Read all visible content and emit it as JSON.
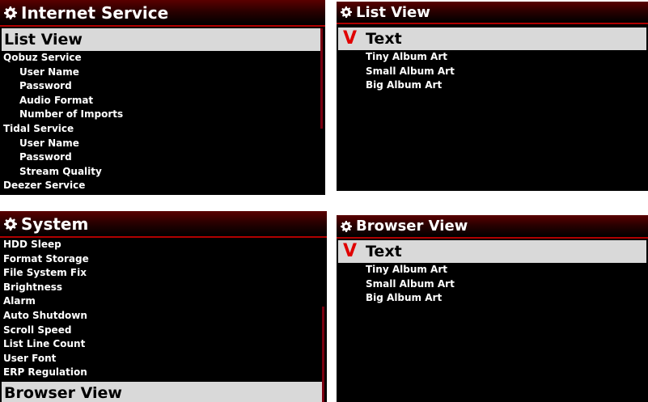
{
  "panels": {
    "internet_service": {
      "title": "Internet Service",
      "selected": "List View",
      "items": [
        {
          "label": "Qobuz Service"
        },
        {
          "label": "User Name"
        },
        {
          "label": "Password"
        },
        {
          "label": "Audio Format"
        },
        {
          "label": "Number of Imports"
        },
        {
          "label": "Tidal Service"
        },
        {
          "label": "User Name"
        },
        {
          "label": "Password"
        },
        {
          "label": "Stream Quality"
        },
        {
          "label": "Deezer Service"
        }
      ]
    },
    "list_view": {
      "title": "List View",
      "check_mark": "V",
      "selected": "Text",
      "options": [
        {
          "label": "Tiny Album Art"
        },
        {
          "label": "Small Album Art"
        },
        {
          "label": "Big Album Art"
        }
      ]
    },
    "system": {
      "title": "System",
      "items": [
        {
          "label": "HDD Sleep"
        },
        {
          "label": "Format Storage"
        },
        {
          "label": "File System Fix"
        },
        {
          "label": "Brightness"
        },
        {
          "label": "Alarm"
        },
        {
          "label": "Auto Shutdown"
        },
        {
          "label": "Scroll Speed"
        },
        {
          "label": "List Line Count"
        },
        {
          "label": "User Font"
        },
        {
          "label": "ERP Regulation"
        }
      ],
      "selected": "Browser View"
    },
    "browser_view": {
      "title": "Browser View",
      "check_mark": "V",
      "selected": "Text",
      "options": [
        {
          "label": "Tiny Album Art"
        },
        {
          "label": "Small Album Art"
        },
        {
          "label": "Big Album Art"
        }
      ]
    }
  },
  "colors": {
    "panel_bg": "#000000",
    "title_gradient_top": "#5a0000",
    "selection_bg": "#d9d9d9",
    "check_mark": "#e00000",
    "scrollbar": "#7a0010"
  },
  "icons": {
    "title_icon": "gear-icon"
  }
}
